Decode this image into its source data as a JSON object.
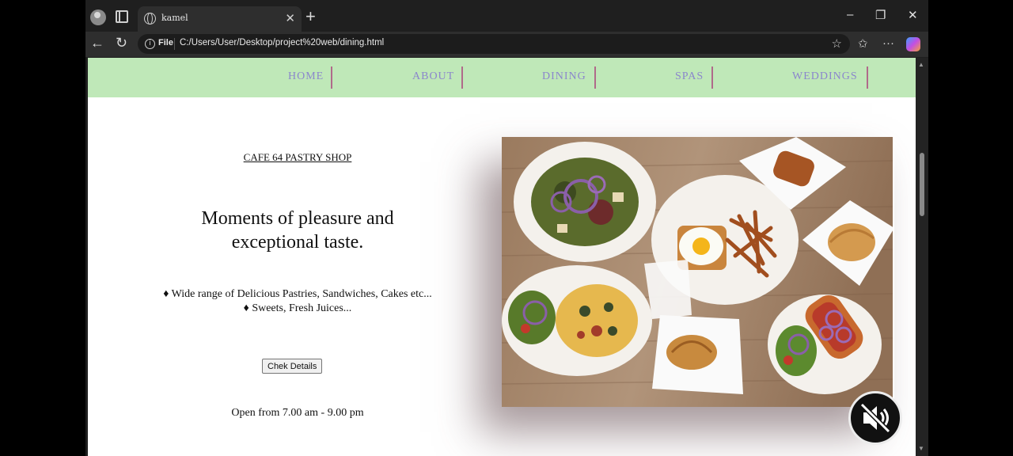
{
  "browser": {
    "tab_title": "kamel",
    "url_scheme": "File",
    "url": "C:/Users/User/Desktop/project%20web/dining.html"
  },
  "nav": {
    "items": [
      "HOME",
      "ABOUT",
      "DINING",
      "SPAS",
      "WEDDINGS"
    ]
  },
  "content": {
    "shop_title": "CAFE 64 PASTRY SHOP",
    "headline_line1": "Moments of pleasure and",
    "headline_line2": "exceptional taste.",
    "feature_1": "♦ Wide range of Delicious Pastries, Sandwiches, Cakes etc...",
    "feature_2": "♦ Sweets, Fresh Juices...",
    "button_label": "Chek Details",
    "hours": "Open from 7.00 am - 9.00 pm"
  },
  "colors": {
    "navbar_bg": "#bfe8b8",
    "nav_link": "#8b86cc",
    "nav_separator": "#b06a8a",
    "browser_chrome": "#1f1f1f"
  },
  "icons": {
    "tab_icon": "globe-icon",
    "mute_overlay": "speaker-muted-icon"
  }
}
